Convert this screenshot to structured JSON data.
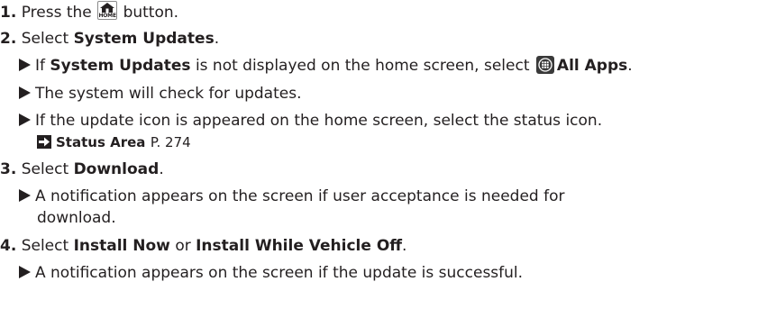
{
  "steps": [
    {
      "num": "1.",
      "pre": "Press the",
      "icon": "home-icon",
      "icon_label": "HOME",
      "post": "button."
    },
    {
      "num": "2.",
      "pre": "Select",
      "bold": "System Updates",
      "post": "."
    },
    {
      "num": "3.",
      "pre": "Select",
      "bold": "Download",
      "post": "."
    },
    {
      "num": "4.",
      "pre": "Select",
      "bold1": "Install Now",
      "mid": "or",
      "bold2": "Install While Vehicle Off",
      "post": "."
    }
  ],
  "notes": {
    "n2a": {
      "pre": "If",
      "bold": "System Updates",
      "mid": "is not displayed on the home screen, select",
      "icon": "all-apps-icon",
      "bold2": "All Apps",
      "post": "."
    },
    "n2b": "The system will check for updates.",
    "n2c": "If the update icon is appeared on the home screen, select the status icon.",
    "xref": {
      "title": "Status Area",
      "page": "P. 274"
    },
    "n3a_line1": "A notification appears on the screen if user acceptance is needed for",
    "n3a_line2": "download.",
    "n4a": "A notification appears on the screen if the update is successful."
  }
}
